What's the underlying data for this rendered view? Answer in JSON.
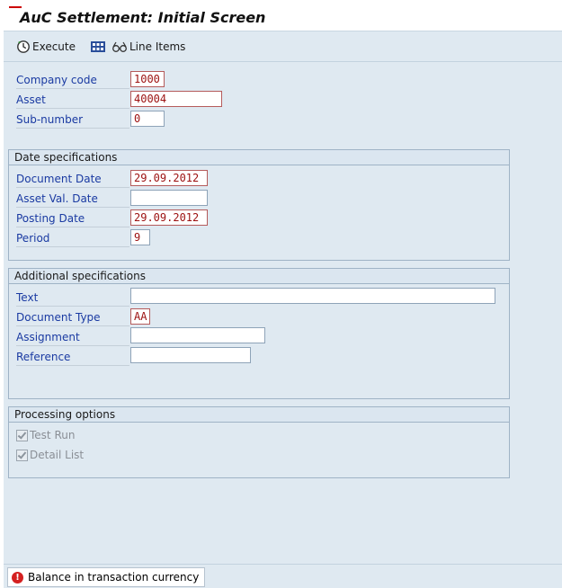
{
  "title": "AuC Settlement: Initial Screen",
  "toolbar": {
    "execute_label": "Execute",
    "execute_icon": "clock-execute-icon",
    "line_items_label": "Line Items",
    "line_items_icon": "glasses-icon"
  },
  "header_fields": [
    {
      "label": "Company code",
      "value": "1000"
    },
    {
      "label": "Asset",
      "value": "40004"
    },
    {
      "label": "Sub-number",
      "value": "0"
    }
  ],
  "date_specifications": {
    "title": "Date specifications",
    "fields": [
      {
        "label": "Document Date",
        "value": "29.09.2012"
      },
      {
        "label": "Asset Val. Date",
        "value": ""
      },
      {
        "label": "Posting Date",
        "value": "29.09.2012"
      },
      {
        "label": "Period",
        "value": "9"
      }
    ]
  },
  "additional_specifications": {
    "title": "Additional specifications",
    "fields": [
      {
        "label": "Text",
        "value": ""
      },
      {
        "label": "Document Type",
        "value": "AA"
      },
      {
        "label": "Assignment",
        "value": ""
      },
      {
        "label": "Reference",
        "value": ""
      }
    ]
  },
  "processing_options": {
    "title": "Processing options",
    "options": [
      {
        "label": "Test Run",
        "checked": true,
        "enabled": false
      },
      {
        "label": "Detail List",
        "checked": true,
        "enabled": false
      }
    ]
  },
  "status": {
    "message": "Balance in transaction currency",
    "type": "error"
  },
  "colors": {
    "label": "#1a3aa2",
    "value": "#9c1010",
    "background": "#dfe9f1",
    "status_error": "#d42020"
  }
}
